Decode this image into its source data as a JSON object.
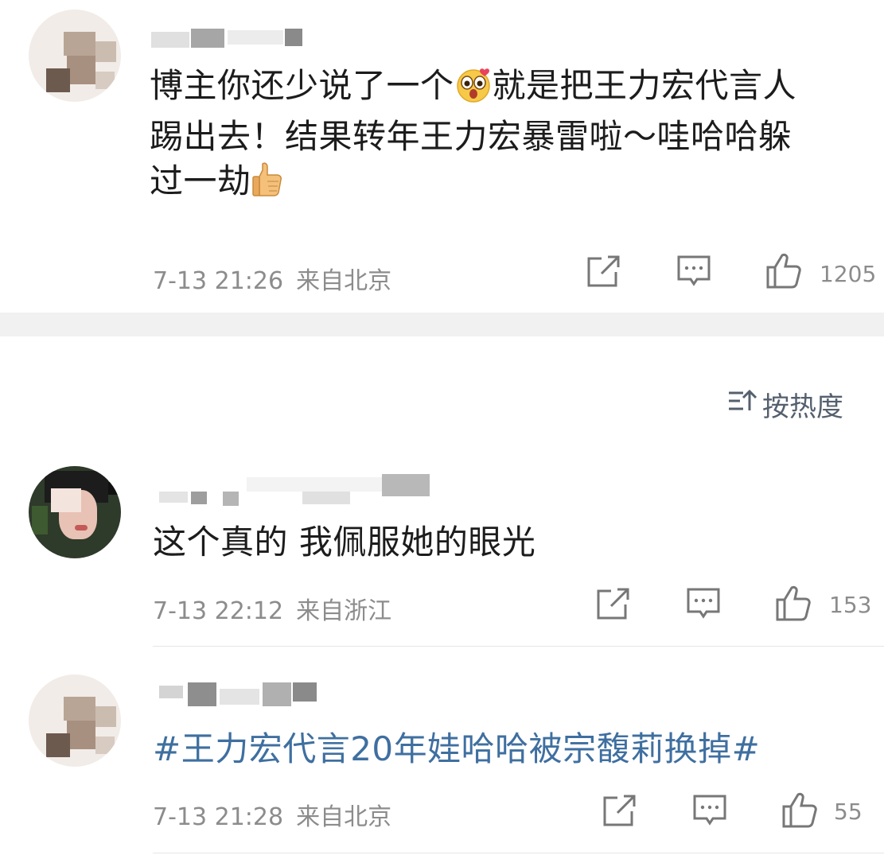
{
  "comments": [
    {
      "text_line1": "博主你还少说了一个",
      "text_line1b": "就是把王力宏代言人",
      "text_line2": "踢出去！结果转年王力宏暴雷啦～哇哈哈躲",
      "text_line3": "过一劫",
      "emoji_inline": "surprised-face-emoji",
      "emoji_end": "thumbs-up-emoji",
      "time": "7-13 21:26",
      "location": "来自北京",
      "likes": "1205"
    },
    {
      "text": "这个真的 我佩服她的眼光",
      "time": "7-13 22:12",
      "location": "来自浙江",
      "likes": "153"
    },
    {
      "text": "#王力宏代言20年娃哈哈被宗馥莉换掉#",
      "time": "7-13 21:28",
      "location": "来自北京",
      "likes": "55"
    }
  ],
  "sort": {
    "label": "按热度",
    "icon": "sort-icon"
  },
  "icons": {
    "share": "share-icon",
    "comment": "comment-icon",
    "like": "like-icon"
  },
  "colors": {
    "topic": "#3f6fa0",
    "meta": "#8c8c8c",
    "band": "#f1f1f1"
  }
}
